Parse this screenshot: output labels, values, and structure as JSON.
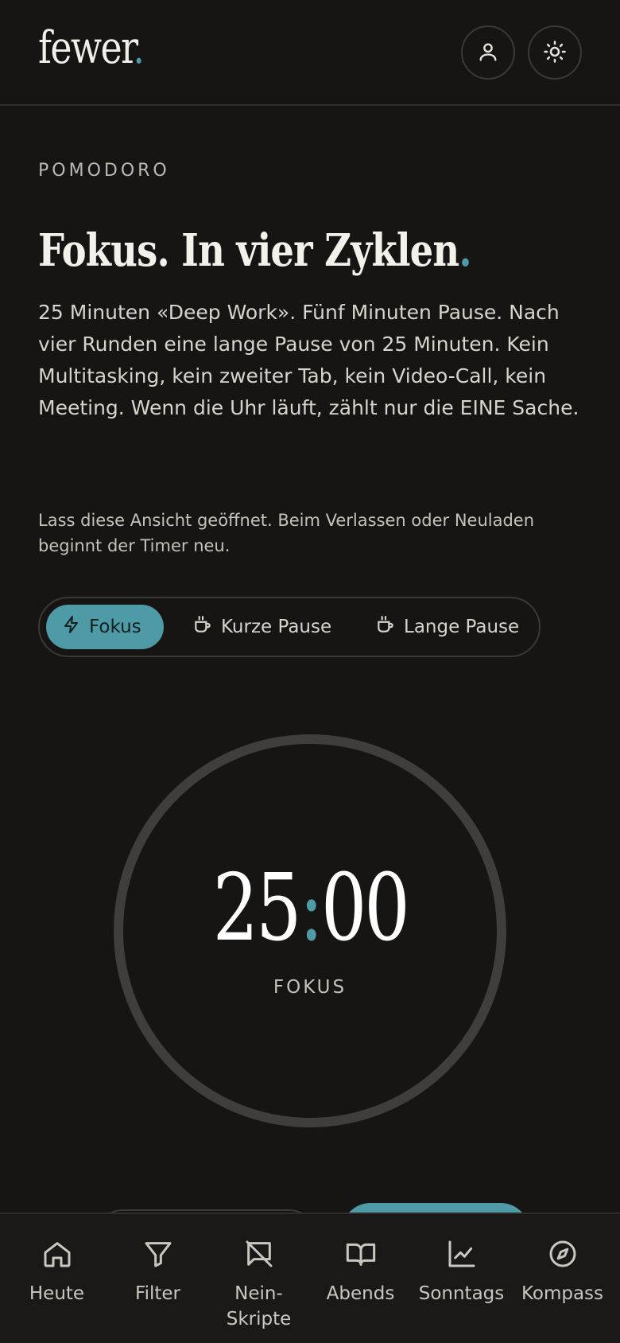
{
  "brand": {
    "name": "fewer",
    "dot": ".",
    "accent": "#4e9aa6"
  },
  "header": {
    "user_icon": "user-icon",
    "theme_icon": "sun-icon"
  },
  "section": {
    "eyebrow": "POMODORO",
    "title": "Fokus. In vier Zyklen",
    "title_dot": ".",
    "lead": "25 Minuten «Deep Work». Fünf Minuten Pause. Nach vier Runden eine lange Pause von 25 Minuten. Kein Multitasking, kein zweiter Tab, kein Video-Call, kein Meeting. Wenn die Uhr läuft, zählt nur die EINE Sache.",
    "note": "Lass diese Ansicht geöffnet. Beim Verlassen oder Neuladen beginnt der Timer neu."
  },
  "modes": [
    {
      "label": "Fokus",
      "icon": "lightning-icon",
      "active": true
    },
    {
      "label": "Kurze Pause",
      "icon": "coffee-cup-icon",
      "active": false
    },
    {
      "label": "Lange Pause",
      "icon": "coffee-cup-icon",
      "active": false
    }
  ],
  "timer": {
    "minutes": "25",
    "colon": ":",
    "seconds": "00",
    "label": "FOKUS",
    "progress": 0
  },
  "nav": [
    {
      "label": "Heute",
      "icon": "home-icon"
    },
    {
      "label": "Filter",
      "icon": "filter-icon"
    },
    {
      "label": "Nein-\nSkripte",
      "label_line1": "Nein-",
      "label_line2": "Skripte",
      "icon": "message-off-icon"
    },
    {
      "label": "Abends",
      "icon": "book-open-icon"
    },
    {
      "label": "Sonntags",
      "icon": "chart-line-icon"
    },
    {
      "label": "Kompass",
      "icon": "compass-icon"
    }
  ]
}
